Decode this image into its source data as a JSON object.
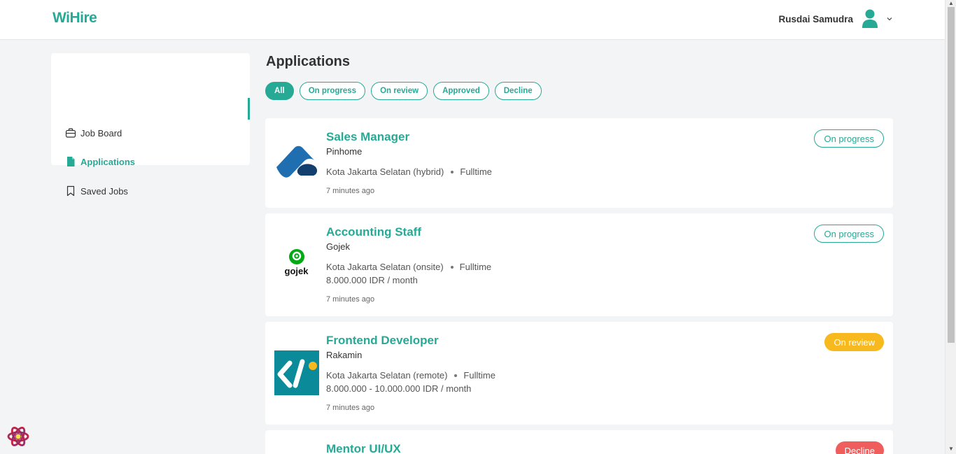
{
  "header": {
    "logo": "WiHire",
    "user_name": "Rusdai Samudra"
  },
  "sidebar": {
    "items": [
      {
        "label": "Job Board",
        "icon": "briefcase-icon"
      },
      {
        "label": "Applications",
        "icon": "document-icon"
      },
      {
        "label": "Saved Jobs",
        "icon": "bookmark-icon"
      }
    ]
  },
  "main": {
    "title": "Applications",
    "filters": [
      "All",
      "On progress",
      "On review",
      "Approved",
      "Decline"
    ]
  },
  "applications": [
    {
      "title": "Sales Manager",
      "company": "Pinhome",
      "location": "Kota Jakarta Selatan (hybrid)",
      "type": "Fulltime",
      "salary": "",
      "time": "7 minutes ago",
      "status": "On progress"
    },
    {
      "title": "Accounting Staff",
      "company": "Gojek",
      "logo_text": "gojek",
      "location": "Kota Jakarta Selatan (onsite)",
      "type": "Fulltime",
      "salary": "8.000.000 IDR / month",
      "time": "7 minutes ago",
      "status": "On progress"
    },
    {
      "title": "Frontend Developer",
      "company": "Rakamin",
      "location": "Kota Jakarta Selatan (remote)",
      "type": "Fulltime",
      "salary": "8.000.000 - 10.000.000 IDR / month",
      "time": "7 minutes ago",
      "status": "On review"
    },
    {
      "title": "Mentor UI/UX",
      "status": "Decline"
    }
  ],
  "colors": {
    "accent": "#26a995",
    "review": "#f8b91f",
    "decline": "#ef5d5d"
  }
}
